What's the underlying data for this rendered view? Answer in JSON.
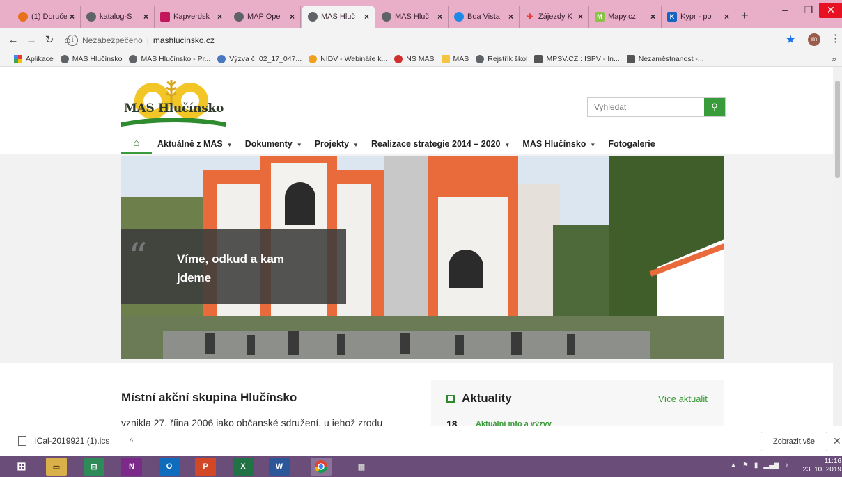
{
  "tabs": [
    {
      "title": "(1) Doruče",
      "icon_color": "#e8711d",
      "active": false
    },
    {
      "title": "katalog-S",
      "icon_color": "#5f6368",
      "active": false
    },
    {
      "title": "Kapverdsk",
      "icon_color": "#c2185b",
      "active": false
    },
    {
      "title": "MAP Ope",
      "icon_color": "#5f6368",
      "active": false
    },
    {
      "title": "MAS Hluč",
      "icon_color": "#5f6368",
      "active": true
    },
    {
      "title": "MAS Hluč",
      "icon_color": "#5f6368",
      "active": false
    },
    {
      "title": "Boa Vista",
      "icon_color": "#1e88e5",
      "active": false
    },
    {
      "title": "Zájezdy K",
      "icon_color": "#e53935",
      "active": false
    },
    {
      "title": "Mapy.cz",
      "icon_color": "#8bc34a",
      "active": false
    },
    {
      "title": "Kypr - po",
      "icon_color": "#1565c0",
      "active": false
    }
  ],
  "window": {
    "minimize": "–",
    "restore": "❐",
    "close": "✕"
  },
  "address": {
    "info_icon": "i",
    "security": "Nezabezpečeno",
    "url": "mashlucinsko.cz",
    "profile_initial": "m"
  },
  "bookmarks": [
    {
      "label": "Aplikace",
      "icon": "apps-icon",
      "color": "#e53935"
    },
    {
      "label": "MAS Hlučínsko",
      "icon": "globe-icon",
      "color": "#5f6368"
    },
    {
      "label": "MAS Hlučínsko - Pr...",
      "icon": "globe-icon",
      "color": "#5f6368"
    },
    {
      "label": "Výzva č. 02_17_047...",
      "icon": "op-icon",
      "color": "#4a78c0"
    },
    {
      "label": "NIDV - Webináře k...",
      "icon": "nidv-icon",
      "color": "#f0a020"
    },
    {
      "label": "NS MAS",
      "icon": "nsmas-icon",
      "color": "#d03030"
    },
    {
      "label": "MAS",
      "icon": "folder-icon",
      "color": "#f4c542"
    },
    {
      "label": "Rejstřík škol",
      "icon": "globe-icon",
      "color": "#5f6368"
    },
    {
      "label": "MPSV.CZ : ISPV - In...",
      "icon": "mpsv-icon",
      "color": "#555555"
    },
    {
      "label": "Nezaměstnanost -...",
      "icon": "mpsv-icon",
      "color": "#555555"
    }
  ],
  "bookmarks_more": "»",
  "site": {
    "logo_text": "MAS Hlučínsko",
    "search_placeholder": "Vyhledat",
    "nav": [
      {
        "label": "Aktuálně z MAS",
        "dropdown": true
      },
      {
        "label": "Dokumenty",
        "dropdown": true
      },
      {
        "label": "Projekty",
        "dropdown": true
      },
      {
        "label": "Realizace strategie 2014 – 2020",
        "dropdown": true
      },
      {
        "label": "MAS Hlučínsko",
        "dropdown": true
      },
      {
        "label": "Fotogalerie",
        "dropdown": false
      }
    ],
    "hero_quote_mark": "“",
    "hero_quote": "Víme, odkud a kam jdeme",
    "about_title": "Místní akční skupina Hlučínsko",
    "about_text": "vznikla 27. října 2006 jako občanské sdružení, u jehož zrodu",
    "news_title": "Aktuality",
    "news_more": "Více aktualit",
    "news_day": "18",
    "news_item": "Aktuální info a výzvy"
  },
  "download": {
    "file": "iCal-2019921 (1).ics",
    "show_all": "Zobrazit vše"
  },
  "taskbar": {
    "time": "11:16",
    "date": "23. 10. 2019"
  },
  "colors": {
    "accent": "#3a9b3a",
    "tabbar": "#e9aec8",
    "taskbar": "#6b4d7a"
  }
}
